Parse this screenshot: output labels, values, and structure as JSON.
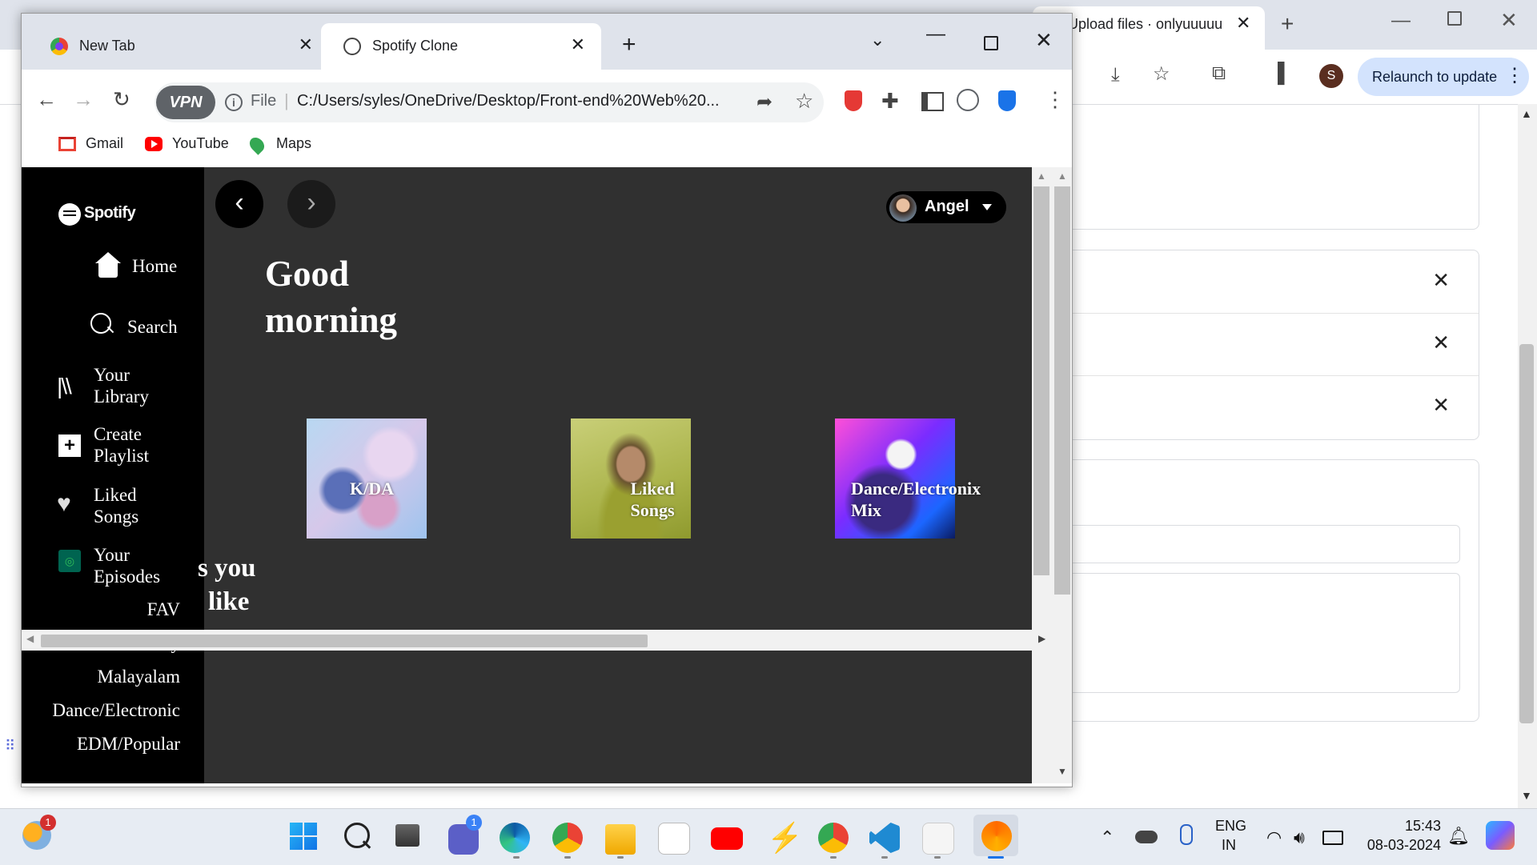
{
  "background_window": {
    "tab_title": "Upload files · onlyuuuuu",
    "tab_close": "✕",
    "new_tab": "+",
    "relaunch_label": "Relaunch to update",
    "avatar_initial": "S",
    "list_close": "✕"
  },
  "browser": {
    "tabs": [
      {
        "title": "New Tab",
        "close": "✕"
      },
      {
        "title": "Spotify Clone",
        "close": "✕"
      }
    ],
    "new_tab": "+",
    "url_scheme": "File",
    "url": "C:/Users/syles/OneDrive/Desktop/Front-end%20Web%20...",
    "vpn_label": "VPN",
    "bookmarks": [
      "Gmail",
      "YouTube",
      "Maps"
    ]
  },
  "spotify": {
    "logo_text": "Spotify",
    "nav": {
      "home": "Home",
      "search": "Search",
      "library_line1": "Your",
      "library_line2": "Library",
      "create_line1": "Create",
      "create_line2": "Playlist",
      "liked_line1": "Liked",
      "liked_line2": "Songs",
      "episodes_line1": "Your",
      "episodes_line2": "Episodes"
    },
    "playlists": [
      "FAV",
      "Discover Weekly",
      "Malayalam",
      "Dance/Electronic",
      "EDM/Popular"
    ],
    "user_name": "Angel",
    "greeting_line1": "Good",
    "greeting_line2": "morning",
    "cards": [
      {
        "label_line1": "K/DA",
        "label_line2": ""
      },
      {
        "label_line1": "Liked",
        "label_line2": "Songs"
      },
      {
        "label_line1": "Dance/Electronix",
        "label_line2": "Mix"
      }
    ],
    "section_line1": "s you",
    "section_line2": "like"
  },
  "taskbar": {
    "weather_badge": "1",
    "teams_badge": "1",
    "lang_line1": "ENG",
    "lang_line2": "IN",
    "time": "15:43",
    "date": "08-03-2024"
  },
  "colors": {
    "spotify_sidebar": "#000000",
    "spotify_main": "#303030",
    "relaunch_pill": "#d3e3fd"
  }
}
